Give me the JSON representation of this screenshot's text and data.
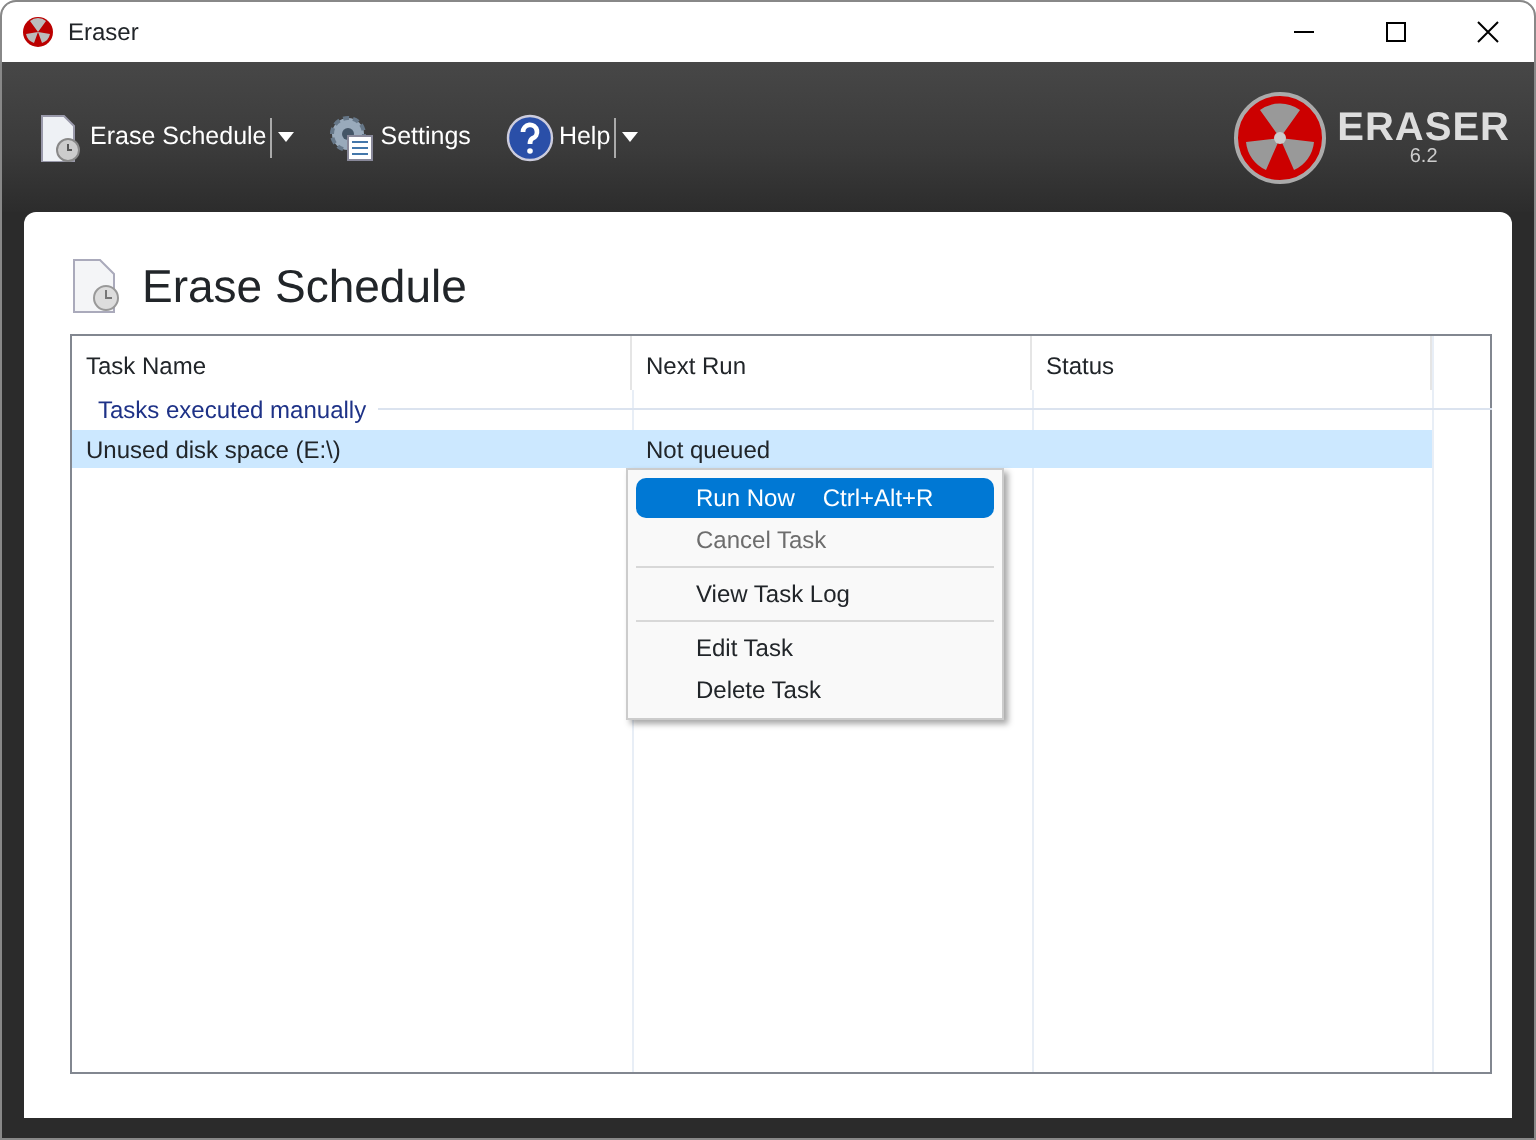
{
  "window": {
    "title": "Eraser"
  },
  "toolbar": [
    {
      "label": "Erase Schedule",
      "dropdown": true
    },
    {
      "label": "Settings",
      "dropdown": false
    },
    {
      "label": "Help",
      "dropdown": true
    }
  ],
  "logo": {
    "name": "ERASER",
    "version": "6.2"
  },
  "page_title": "Erase Schedule",
  "table": {
    "columns": [
      "Task Name",
      "Next Run",
      "Status"
    ],
    "group": "Tasks executed manually",
    "rows": [
      {
        "task_name": "Unused disk space (E:\\)",
        "next_run": "Not queued",
        "status": "",
        "selected": true
      }
    ]
  },
  "context_menu": [
    {
      "kind": "item",
      "label": "Run Now",
      "shortcut": "Ctrl+Alt+R",
      "selected": true,
      "disabled": false
    },
    {
      "kind": "item",
      "label": "Cancel Task",
      "selected": false,
      "disabled": true
    },
    {
      "kind": "separator"
    },
    {
      "kind": "item",
      "label": "View Task Log",
      "selected": false,
      "disabled": false
    },
    {
      "kind": "separator"
    },
    {
      "kind": "item",
      "label": "Edit Task",
      "selected": false,
      "disabled": false
    },
    {
      "kind": "item",
      "label": "Delete Task",
      "selected": false,
      "disabled": false
    }
  ]
}
